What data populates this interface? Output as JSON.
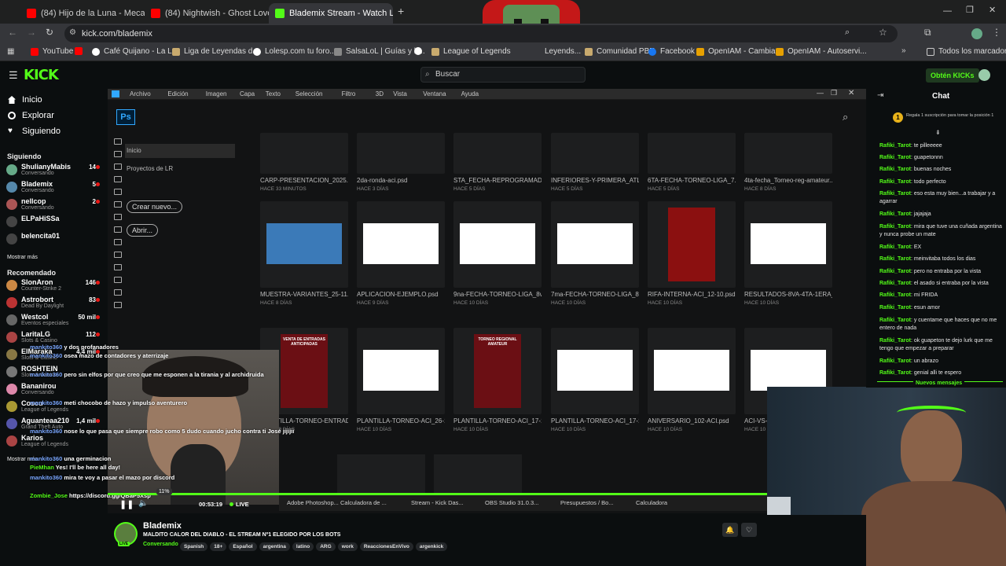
{
  "browser": {
    "tabs": [
      {
        "label": "(84) Hijo de la Luna - Meca",
        "color": "#ff0000"
      },
      {
        "label": "(84) Nightwish - Ghost Love Sc",
        "color": "#ff0000"
      },
      {
        "label": "Blademix Stream - Watch Li",
        "color": "#53fc18"
      }
    ],
    "new_tab": "+",
    "url": "kick.com/blademix",
    "bookmarks": [
      {
        "label": "YouTube",
        "color": "#ff0000"
      },
      {
        "label": "",
        "color": "#ff0000"
      },
      {
        "label": "Café Quijano - La L...",
        "color": "#ffffff"
      },
      {
        "label": "Liga de Leyendas d...",
        "color": "#c8aa6e"
      },
      {
        "label": "Lolesp.com tu foro...",
        "color": "#ffffff"
      },
      {
        "label": "SalsaLoL | Guías y b...",
        "color": "#888888"
      },
      {
        "label": "",
        "color": "#ffffff"
      },
      {
        "label": "League of Legends",
        "color": "#c8aa6e"
      },
      {
        "label": "Leyends...",
        "color": "#c8aa6e"
      },
      {
        "label": "Comunidad PBE",
        "color": "#c8aa6e"
      },
      {
        "label": "Facebook",
        "color": "#1877f2"
      },
      {
        "label": "OpenIAM - Cambiar...",
        "color": "#e6a000"
      },
      {
        "label": "OpenIAM - Autoservi...",
        "color": "#e6a000"
      }
    ],
    "all_bookmarks": "Todos los marcadores"
  },
  "kick": {
    "logo": "KICK",
    "search_placeholder": "Buscar",
    "obtain": "Obtén KICKs"
  },
  "sidebar": {
    "nav": [
      {
        "label": "Inicio"
      },
      {
        "label": "Explorar"
      },
      {
        "label": "Siguiendo"
      }
    ],
    "following_title": "Siguiendo",
    "following": [
      {
        "name": "ShulianyMabis",
        "game": "Conversando",
        "viewers": "14",
        "color": "#6a8"
      },
      {
        "name": "Blademix",
        "game": "Conversando",
        "viewers": "5",
        "color": "#58a"
      },
      {
        "name": "nellcop",
        "game": "Conversando",
        "viewers": "2",
        "color": "#a55"
      },
      {
        "name": "ELPaHiSSa",
        "game": "",
        "viewers": "",
        "color": "#444"
      },
      {
        "name": "belencita01",
        "game": "",
        "viewers": "",
        "color": "#444"
      }
    ],
    "show_more": "Mostrar más",
    "recommended_title": "Recomendado",
    "recommended": [
      {
        "name": "SlonAron",
        "game": "Counter-Strike 2",
        "viewers": "146",
        "color": "#c84"
      },
      {
        "name": "Astrobort",
        "game": "Dead By Daylight",
        "viewers": "83",
        "color": "#b33"
      },
      {
        "name": "Westcol",
        "game": "Eventos especiales",
        "viewers": "50 mil",
        "color": "#666"
      },
      {
        "name": "LaritaLG",
        "game": "Slots & Casino",
        "viewers": "112",
        "color": "#a44"
      },
      {
        "name": "ElMaraka",
        "game": "Slots & Casino",
        "viewers": "4,4 mil",
        "color": "#874"
      },
      {
        "name": "ROSHTEIN",
        "game": "Slots & Casino",
        "viewers": "",
        "color": "#777"
      },
      {
        "name": "Bananirou",
        "game": "Conversando",
        "viewers": "",
        "color": "#d8a"
      },
      {
        "name": "Coscu",
        "game": "League of Legends",
        "viewers": "",
        "color": "#a93"
      },
      {
        "name": "Aguanteaa210",
        "game": "Grand Theft Auto",
        "viewers": "1,4 mil",
        "color": "#55a"
      },
      {
        "name": "Karios",
        "game": "League of Legends",
        "viewers": "",
        "color": "#a44"
      }
    ],
    "show_more2": "Mostrar más"
  },
  "photoshop": {
    "menu": [
      "Archivo",
      "Edición",
      "Imagen",
      "Capa",
      "Texto",
      "Selección",
      "Filtro",
      "3D",
      "Vista",
      "Ventana",
      "Ayuda"
    ],
    "icon": "Ps",
    "left": {
      "inicio": "Inicio",
      "projects": "Proyectos de LR",
      "new": "Crear nuevo...",
      "open": "Abrir..."
    },
    "row1": [
      {
        "name": "CARP-PRESENTACION_2025.psd",
        "date": "HACE 33 MINUTOS"
      },
      {
        "name": "2da-ronda-aci.psd",
        "date": "HACE 3 DÍAS"
      },
      {
        "name": "STA_FECHA-REPROGRAMADA...",
        "date": "HACE 5 DÍAS"
      },
      {
        "name": "INFERIORES-Y-PRIMERA_ATLE...",
        "date": "HACE 5 DÍAS"
      },
      {
        "name": "6TA-FECHA-TORNEO-LIGA_7...",
        "date": "HACE 5 DÍAS"
      },
      {
        "name": "4ta-fecha_Torneo-reg-amateur...",
        "date": "HACE 8 DÍAS"
      }
    ],
    "row2": [
      {
        "name": "MUESTRA-VARIANTES_25-11.psd",
        "date": "HACE 8 DÍAS",
        "color": "#3b7ab8"
      },
      {
        "name": "APLICACION-EJEMPLO.psd",
        "date": "HACE 9 DÍAS",
        "color": "#ffffff"
      },
      {
        "name": "9na-FECHA-TORNEO-LIGA_8v...",
        "date": "HACE 10 DÍAS",
        "color": "#ffffff"
      },
      {
        "name": "7ma-FECHA-TORNEO-LIGA_8...",
        "date": "HACE 10 DÍAS",
        "color": "#ffffff"
      },
      {
        "name": "RIFA-INTERNA-ACI_12-10.psd",
        "date": "HACE 10 DÍAS",
        "color": "#8b1010"
      },
      {
        "name": "RESULTADOS-8VA-4TA-1ERA_T...",
        "date": "HACE 10 DÍAS",
        "color": "#ffffff"
      }
    ],
    "row3": [
      {
        "name": "PLANTILLA-TORNEO-ENTRAD...",
        "date": "HACE 10 DÍAS",
        "color": "#6b0f14",
        "label": "VENTA DE ENTRADAS ANTICIPADAS"
      },
      {
        "name": "PLANTILLA-TORNEO-ACI_26-1...",
        "date": "HACE 10 DÍAS",
        "color": "#ffffff",
        "label": ""
      },
      {
        "name": "PLANTILLA-TORNEO-ACI_17-1...",
        "date": "HACE 10 DÍAS",
        "color": "#6b0f14",
        "label": "TORNEO REGIONAL AMATEUR"
      },
      {
        "name": "PLANTILLA-TORNEO-ACI_17-1...",
        "date": "HACE 10 DÍAS",
        "color": "#ffffff",
        "label": ""
      },
      {
        "name": "ANIVERSARIO_102-ACI.psd",
        "date": "HACE 10 DÍAS",
        "color": "#ffffff",
        "label": ""
      },
      {
        "name": "ACI-VS-JI...",
        "date": "HACE 10 DÍAS",
        "color": "#ffffff",
        "label": ""
      }
    ]
  },
  "overlay_chat": [
    {
      "user": "mankito360",
      "text": "y dos profanadores"
    },
    {
      "user": "mankito360",
      "text": "osea mazo de contadores y aterrizaje"
    },
    {
      "user": "mankito360",
      "text": "pero sin elfos por que creo que me esponen a la tirania y al archidruida"
    },
    {
      "user": "mankito360",
      "text": "meti chocobo de hazo y impulso aventurero"
    },
    {
      "user": "mankito360",
      "text": "nose lo que pasa que siempre robo como 5 dudo cuando jucho contra ti José jijijii"
    },
    {
      "user": "mankito360",
      "text": "una germinacion"
    },
    {
      "user": "PieMhan",
      "text": "Yes! I'll be here all day!"
    },
    {
      "user": "mankito360",
      "text": "mira te voy a pasar el mazo por discord"
    },
    {
      "user": "Zombie_Jose",
      "text": "https://discord.gg/QBaP5Xsp"
    }
  ],
  "player": {
    "time": "00:53:19",
    "live": "LIVE",
    "volume": "11%",
    "taskbar": [
      "Adobe Photoshop...",
      "Calculadora de ...",
      "Stream - Kick Das...",
      "OBS Studio 31.0.3...",
      "Presupuestos / Bo...",
      "Calculadora"
    ]
  },
  "stream": {
    "name": "Blademix",
    "title": "MALDITO CALOR DEL DIABLO - EL STREAM Nº1 ELEGIDO POR LOS BOTS",
    "category": "Conversando",
    "tags": [
      "Spanish",
      "18+",
      "Español",
      "argentina",
      "latino",
      "ARG",
      "work",
      "ReaccionesEnVivo",
      "argenkick"
    ]
  },
  "chat": {
    "title": "Chat",
    "gift": "Regala 1 suscripción para tomar la posición 1",
    "gift_rank": "1",
    "new_messages": "Nuevos mensajes",
    "messages": [
      {
        "user": "Rafiki_Tarot",
        "text": "te pilleeeee"
      },
      {
        "user": "Rafiki_Tarot",
        "text": "guapetonnn"
      },
      {
        "user": "Rafiki_Tarot",
        "text": "buenas noches"
      },
      {
        "user": "Rafiki_Tarot",
        "text": "todo perfecto"
      },
      {
        "user": "Rafiki_Tarot",
        "text": "eso esta muy bien...a trabajar y a agarrar"
      },
      {
        "user": "Rafiki_Tarot",
        "text": "jajajaja"
      },
      {
        "user": "Rafiki_Tarot",
        "text": "mira que tuve una cuñada argentina y nunca probe un mate"
      },
      {
        "user": "Rafiki_Tarot",
        "text": "EX"
      },
      {
        "user": "Rafiki_Tarot",
        "text": "meinvitaba todos los dias"
      },
      {
        "user": "Rafiki_Tarot",
        "text": "pero no entraba por la vista"
      },
      {
        "user": "Rafiki_Tarot",
        "text": "el asado si entraba por la vista"
      },
      {
        "user": "Rafiki_Tarot",
        "text": "mi FRIDA"
      },
      {
        "user": "Rafiki_Tarot",
        "text": "esun amor"
      },
      {
        "user": "Rafiki_Tarot",
        "text": "y cuentame que haces que no me entero de nada"
      },
      {
        "user": "Rafiki_Tarot",
        "text": "ok guapeton te dejo lurk que me tengo que empezar a preparar"
      },
      {
        "user": "Rafiki_Tarot",
        "text": "un abrazo"
      },
      {
        "user": "Rafiki_Tarot",
        "text": "genial alli te espero"
      }
    ]
  }
}
